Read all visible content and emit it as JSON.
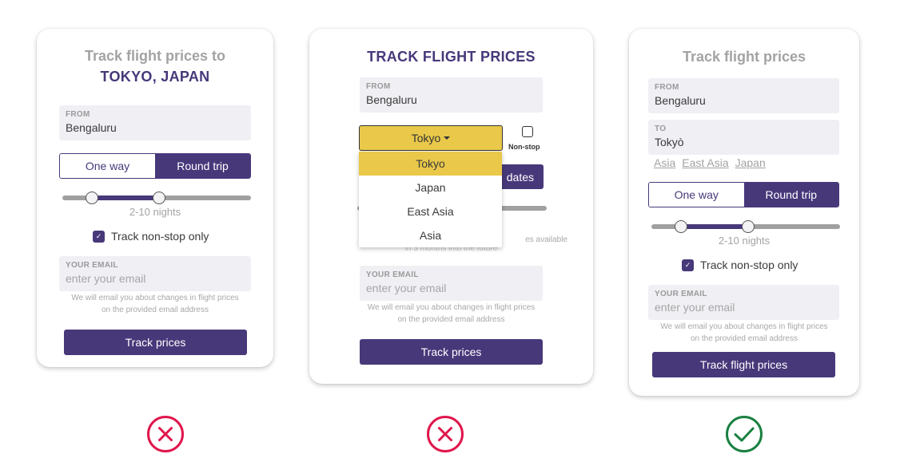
{
  "colors": {
    "brand_purple": "#47387a",
    "accent_yellow": "#e9c84a",
    "field_bg": "#f0eff4",
    "bad": "#e0164b",
    "good": "#1a8040"
  },
  "cards": [
    {
      "title_line1": "Track flight prices to",
      "title_line2": "TOKYO, JAPAN",
      "from_label": "FROM",
      "from_value": "Bengaluru",
      "trip_options": [
        "One way",
        "Round trip"
      ],
      "trip_selected": "Round trip",
      "nights_range": "2-10 nights",
      "nonstop_label": "Track non-stop only",
      "nonstop_checked": true,
      "email_label": "YOUR EMAIL",
      "email_placeholder": "enter your email",
      "hint_line1": "We will email you about changes in flight prices",
      "hint_line2": "on the provided email address",
      "submit_label": "Track  prices",
      "verdict": "incorrect"
    },
    {
      "title": "TRACK FLIGHT PRICES",
      "from_label": "FROM",
      "from_value": "Bengaluru",
      "destination_selected": "Tokyo",
      "destination_options": [
        "Tokyo",
        "Japan",
        "East Asia",
        "Asia"
      ],
      "nonstop_label": "Non-stop",
      "nonstop_checked": false,
      "hidden_button_fragment": "dates",
      "hidden_hint_fragment1": "es available",
      "hidden_hint_fragment2": "in 3 months into the future",
      "email_label": "YOUR EMAIL",
      "email_placeholder": "enter your email",
      "hint_line1": "We will email you about changes in flight prices",
      "hint_line2": "on the provided email address",
      "submit_label": "Track prices",
      "verdict": "incorrect"
    },
    {
      "title": "Track flight prices",
      "from_label": "FROM",
      "from_value": "Bengaluru",
      "to_label": "TO",
      "to_value": "Tokyò",
      "suggestions": [
        "Asia",
        "East Asia",
        "Japan"
      ],
      "trip_options": [
        "One way",
        "Round trip"
      ],
      "trip_selected": "Round trip",
      "nights_range": "2-10 nights",
      "nonstop_label": "Track non-stop only",
      "nonstop_checked": true,
      "email_label": "YOUR EMAIL",
      "email_placeholder": "enter your email",
      "hint_line1": "We will email you about changes in flight prices",
      "hint_line2": "on the provided email address",
      "submit_label": "Track flight prices",
      "verdict": "correct"
    }
  ],
  "icons": {
    "check_mark": "✓",
    "bad_verdict": "x-circle-icon",
    "good_verdict": "check-circle-icon"
  }
}
